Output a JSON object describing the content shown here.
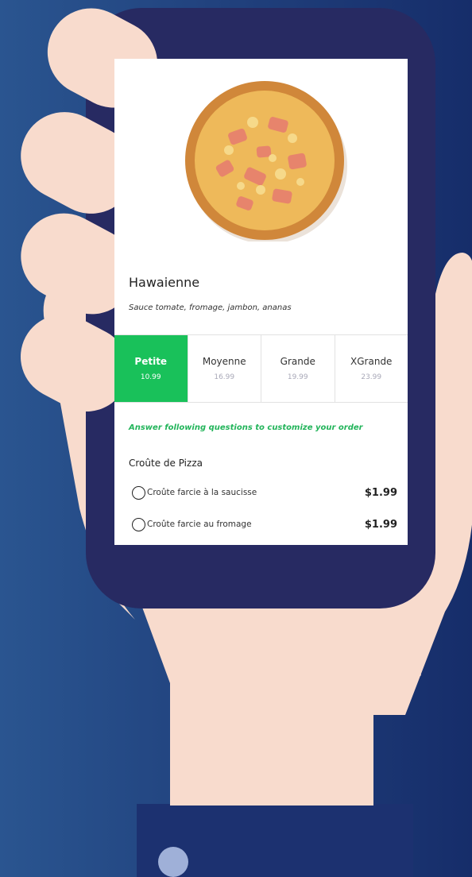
{
  "product": {
    "name": "Hawaienne",
    "description": "Sauce tomate, fromage, jambon, ananas"
  },
  "sizes": [
    {
      "name": "Petite",
      "price": "10.99",
      "selected": true
    },
    {
      "name": "Moyenne",
      "price": "16.99",
      "selected": false
    },
    {
      "name": "Grande",
      "price": "19.99",
      "selected": false
    },
    {
      "name": "XGrande",
      "price": "23.99",
      "selected": false
    }
  ],
  "customize_hint": "Answer following questions to customize your order",
  "crust": {
    "title": "Croûte de Pizza",
    "options": [
      {
        "label": "Croûte farcie à la saucisse",
        "price": "$1.99"
      },
      {
        "label": "Croûte farcie au fromage",
        "price": "$1.99"
      }
    ]
  },
  "colors": {
    "accent_green": "#19c15a",
    "hint_green": "#22b45a",
    "phone_body": "#272a62",
    "skin": "#f8dbcd",
    "sleeve": "#1c3170",
    "background": "#21427e"
  }
}
